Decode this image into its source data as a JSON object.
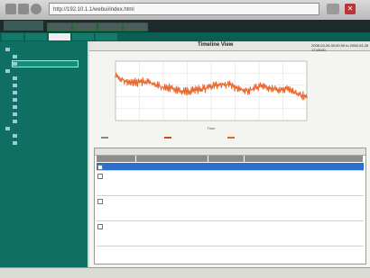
{
  "browser": {
    "address": "http://192.10.1.1/webui/index.html"
  },
  "app": {
    "logo": "",
    "tabs": [
      "",
      "",
      "",
      "",
      ""
    ]
  },
  "sidebar": {
    "items": [
      {
        "label": "",
        "level": 0
      },
      {
        "label": "",
        "level": 1
      },
      {
        "label": "",
        "level": 1,
        "selected": true
      },
      {
        "label": "",
        "level": 0
      },
      {
        "label": "",
        "level": 1
      },
      {
        "label": "",
        "level": 1
      },
      {
        "label": "",
        "level": 1
      },
      {
        "label": "",
        "level": 1
      },
      {
        "label": "",
        "level": 1
      },
      {
        "label": "",
        "level": 1
      },
      {
        "label": "",
        "level": 1
      },
      {
        "label": "",
        "level": 0
      },
      {
        "label": "",
        "level": 1
      },
      {
        "label": "",
        "level": 1
      }
    ]
  },
  "chart": {
    "title": "Timeline View",
    "range": "2008-03-26 00:00:00 to 2008-03-26 17:45:00",
    "colors": {
      "line": "#e8642a",
      "grid": "#dddddd",
      "axis": "#555555"
    }
  },
  "chart_data": {
    "type": "line",
    "title": "Timeline View",
    "xlabel": "Time",
    "ylabel": "",
    "ylim": [
      0,
      1
    ],
    "x": [
      0,
      0.05,
      0.1,
      0.15,
      0.2,
      0.25,
      0.3,
      0.35,
      0.4,
      0.45,
      0.5,
      0.55,
      0.6,
      0.65,
      0.7,
      0.75,
      0.8,
      0.85,
      0.9,
      0.95,
      1.0
    ],
    "series": [
      {
        "name": "",
        "color": "#e8642a",
        "values": [
          0.74,
          0.67,
          0.64,
          0.66,
          0.62,
          0.56,
          0.54,
          0.5,
          0.5,
          0.53,
          0.56,
          0.62,
          0.6,
          0.52,
          0.5,
          0.58,
          0.56,
          0.5,
          0.55,
          0.45,
          0.4
        ]
      }
    ]
  },
  "legend": {
    "items": [
      {
        "label": "",
        "color": "#888888"
      },
      {
        "label": "",
        "color": "#cc4a1a"
      },
      {
        "label": "",
        "color": "#e8642a"
      }
    ],
    "right_label": ""
  },
  "table": {
    "toolbar_label": "",
    "headers": [
      "",
      "",
      "",
      ""
    ],
    "rows": [
      {
        "col1": "",
        "col2": "",
        "col3": "",
        "col4": "",
        "selected": true
      },
      {
        "col1": "",
        "col2": "",
        "col3": "",
        "col4": ""
      },
      {
        "col1": "",
        "col2": "",
        "col3": "",
        "col4": ""
      },
      {
        "col1": "",
        "col2": "",
        "col3": "",
        "col4": ""
      }
    ]
  },
  "status": {
    "text": ""
  }
}
